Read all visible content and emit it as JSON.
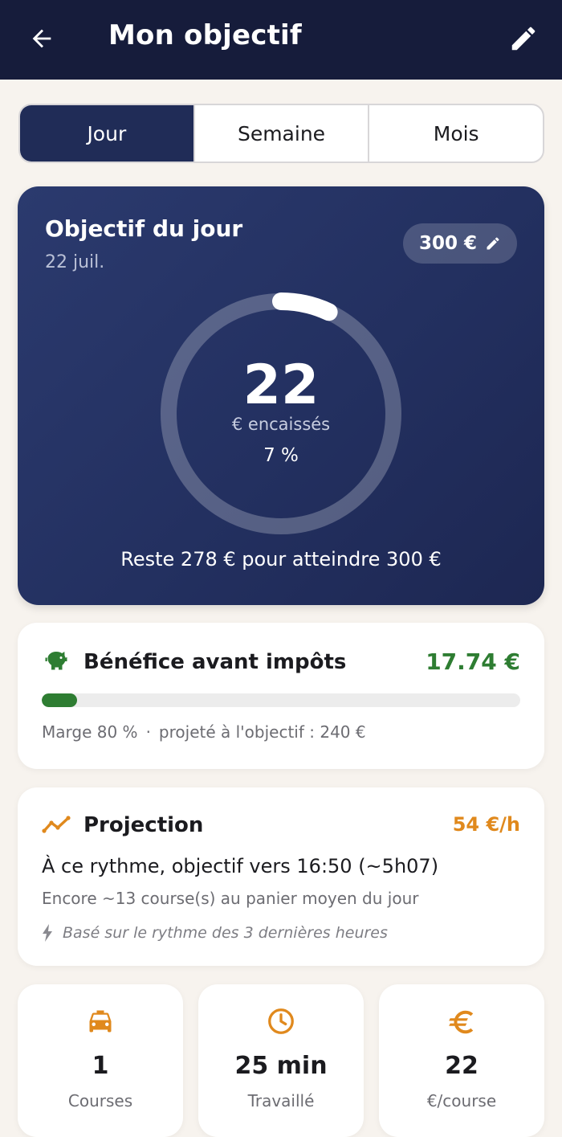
{
  "header": {
    "title": "Mon objectif"
  },
  "tabs": [
    {
      "label": "Jour",
      "active": true
    },
    {
      "label": "Semaine",
      "active": false
    },
    {
      "label": "Mois",
      "active": false
    }
  ],
  "goal": {
    "title": "Objectif du jour",
    "date": "22 juil.",
    "target_label": "300 €",
    "amount": "22",
    "amount_caption": "€ encaissés",
    "percent_label": "7 %",
    "progress_fraction": 0.07,
    "remaining_text": "Reste 278 € pour atteindre 300 €"
  },
  "profit": {
    "label": "Bénéfice avant impôts",
    "value": "17.74 €",
    "bar_fraction": 0.074,
    "margin": "Marge 80 %",
    "separator": "·",
    "projected": "projeté à l'objectif : 240 €",
    "icon": "piggy-bank-icon"
  },
  "projection": {
    "label": "Projection",
    "rate": "54 €/h",
    "main": "À ce rythme, objectif vers 16:50  (~5h07)",
    "secondary": "Encore ~13 course(s) au panier moyen du jour",
    "note": "Basé sur le rythme des 3 dernières heures",
    "icon": "trend-line-icon"
  },
  "stats": [
    {
      "value": "1",
      "label": "Courses",
      "icon": "taxi-icon"
    },
    {
      "value": "25 min",
      "label": "Travaillé",
      "icon": "clock-icon"
    },
    {
      "value": "22",
      "label": "€/course",
      "icon": "euro-icon"
    }
  ],
  "colors": {
    "header_bg": "#161c3b",
    "active_tab": "#202c57",
    "profit_green": "#2e7d32",
    "accent_orange": "#e0891d"
  }
}
